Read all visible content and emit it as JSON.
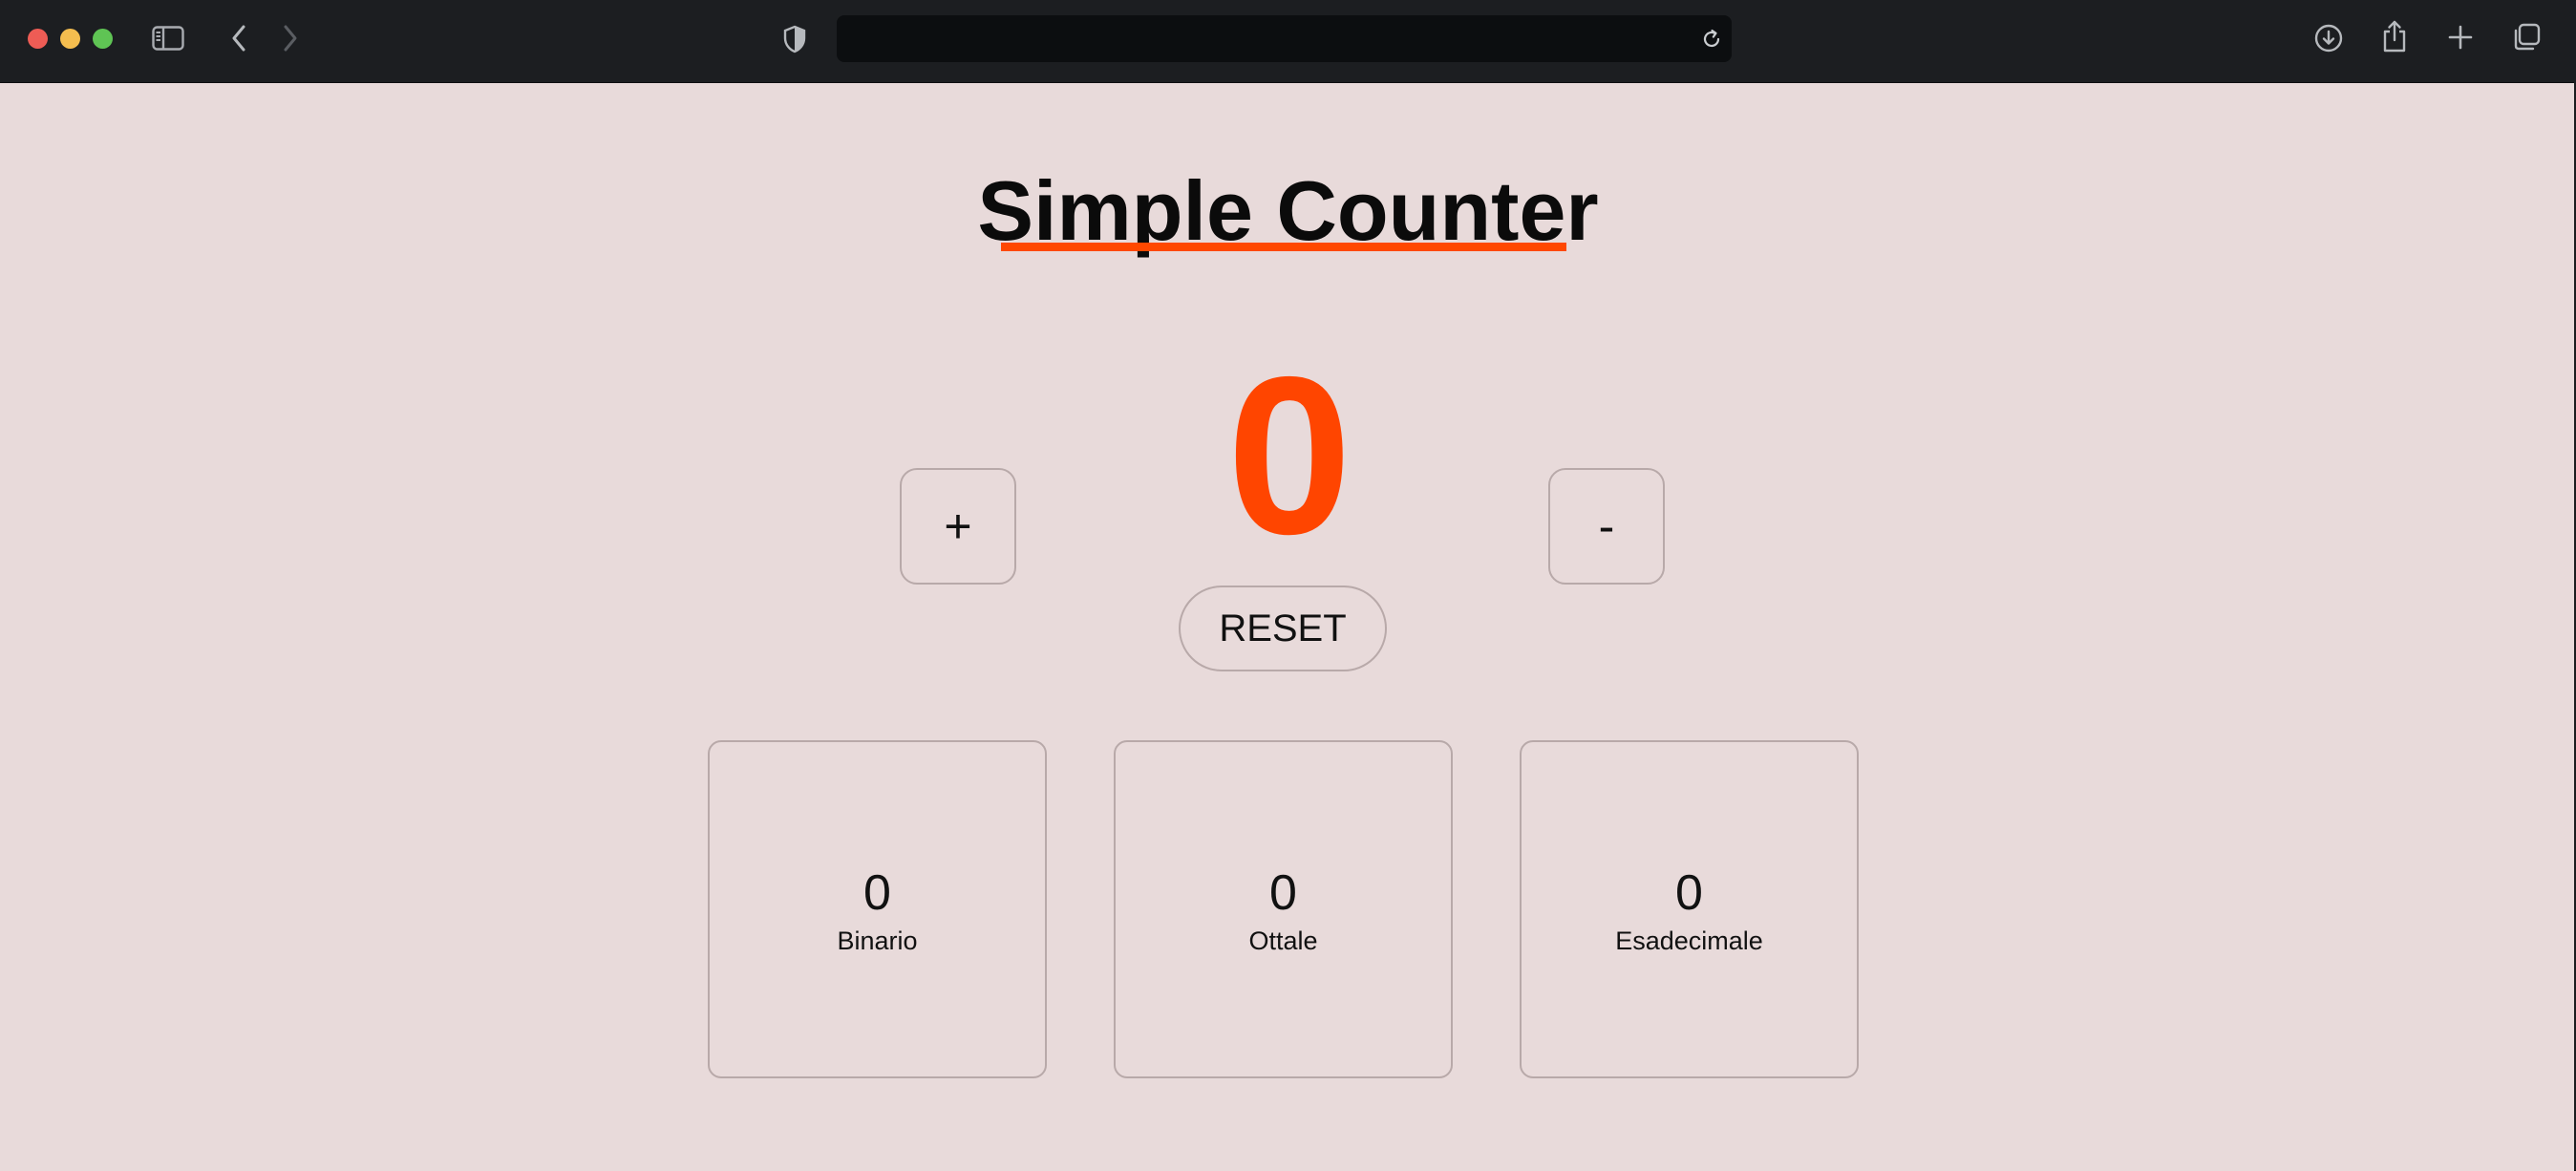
{
  "browser": {
    "address_text": "",
    "icons": {
      "sidebar": "sidebar-icon",
      "back": "chevron-left-icon",
      "forward": "chevron-right-icon",
      "privacy": "shield-icon",
      "reload": "reload-icon",
      "download": "download-icon",
      "share": "share-icon",
      "new_tab": "plus-icon",
      "tabs": "tab-overview-icon"
    }
  },
  "page": {
    "title": "Simple Counter",
    "counter_value": "0",
    "increment_label": "+",
    "decrement_label": "-",
    "reset_label": "RESET",
    "cards": [
      {
        "value": "0",
        "label": "Binario"
      },
      {
        "value": "0",
        "label": "Ottale"
      },
      {
        "value": "0",
        "label": "Esadecimale"
      }
    ]
  },
  "colors": {
    "background": "#e8dada",
    "accent": "#ff4500",
    "border": "#b8a9a9",
    "toolbar": "#1c1e21"
  }
}
